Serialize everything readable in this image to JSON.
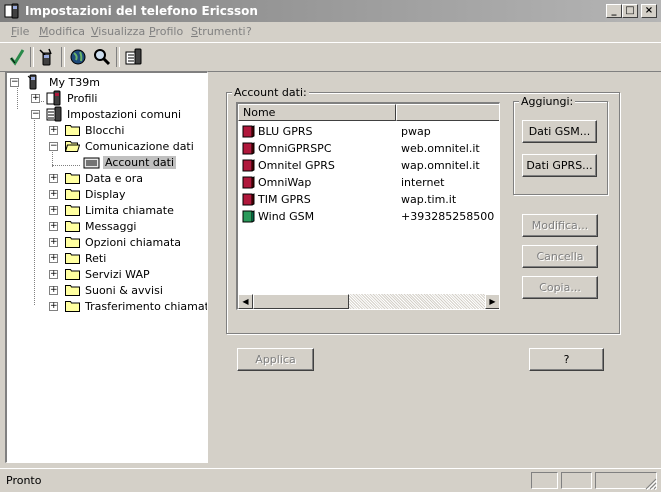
{
  "window": {
    "title": "Impostazioni del telefono Ericsson",
    "min": "_",
    "max": "□",
    "close": "×"
  },
  "menu": [
    "File",
    "Modifica",
    "Visualizza",
    "Profilo",
    "Strumenti",
    "?"
  ],
  "tree": {
    "root": "My T39m",
    "profili": "Profili",
    "impostazioni": "Impostazioni comuni",
    "items": [
      "Blocchi",
      "Comunicazione dati",
      "Data e ora",
      "Display",
      "Limita chiamate",
      "Messaggi",
      "Opzioni chiamata",
      "Reti",
      "Servizi WAP",
      "Suoni & avvisi",
      "Trasferimento chiamate"
    ],
    "account": "Account dati"
  },
  "panel": {
    "group_title": "Account dati:",
    "col_name": "Nome",
    "col_value": "",
    "rows": [
      {
        "name": "BLU GPRS",
        "value": "pwap",
        "icon_color": "#b0183c"
      },
      {
        "name": "OmniGPRSPC",
        "value": "web.omnitel.it",
        "icon_color": "#b0183c"
      },
      {
        "name": "Omnitel GPRS",
        "value": "wap.omnitel.it",
        "icon_color": "#b0183c"
      },
      {
        "name": "OmniWap",
        "value": "internet",
        "icon_color": "#b0183c"
      },
      {
        "name": "TIM GPRS",
        "value": "wap.tim.it",
        "icon_color": "#b0183c"
      },
      {
        "name": "Wind GSM",
        "value": "+393285258500",
        "icon_color": "#2a9a5a"
      }
    ],
    "aggiungi_title": "Aggiungi:",
    "btn_gsm": "Dati GSM...",
    "btn_gprs": "Dati GPRS...",
    "btn_modifica": "Modifica...",
    "btn_cancella": "Cancella",
    "btn_copia": "Copia...",
    "btn_applica": "Applica",
    "btn_help": "?"
  },
  "status": {
    "text": "Pronto"
  }
}
